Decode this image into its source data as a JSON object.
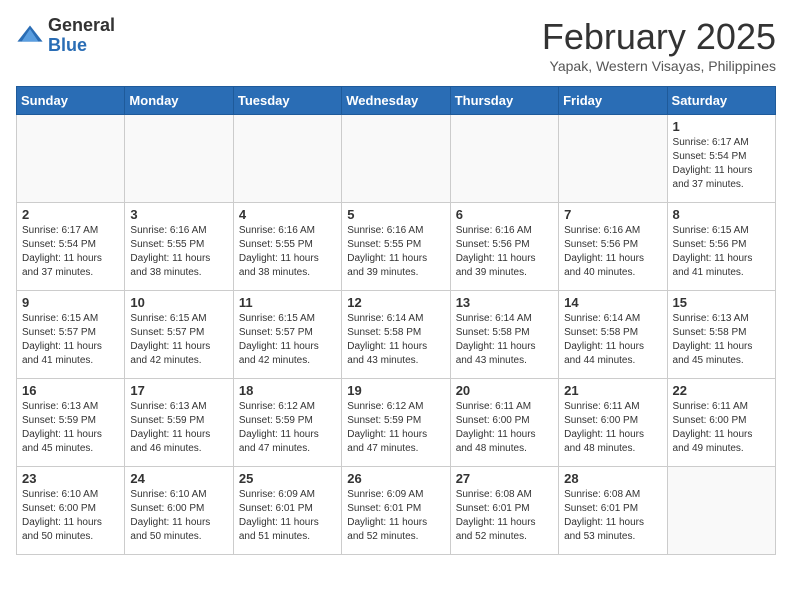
{
  "header": {
    "logo_general": "General",
    "logo_blue": "Blue",
    "month_title": "February 2025",
    "location": "Yapak, Western Visayas, Philippines"
  },
  "days_of_week": [
    "Sunday",
    "Monday",
    "Tuesday",
    "Wednesday",
    "Thursday",
    "Friday",
    "Saturday"
  ],
  "weeks": [
    [
      {
        "day": "",
        "info": ""
      },
      {
        "day": "",
        "info": ""
      },
      {
        "day": "",
        "info": ""
      },
      {
        "day": "",
        "info": ""
      },
      {
        "day": "",
        "info": ""
      },
      {
        "day": "",
        "info": ""
      },
      {
        "day": "1",
        "info": "Sunrise: 6:17 AM\nSunset: 5:54 PM\nDaylight: 11 hours\nand 37 minutes."
      }
    ],
    [
      {
        "day": "2",
        "info": "Sunrise: 6:17 AM\nSunset: 5:54 PM\nDaylight: 11 hours\nand 37 minutes."
      },
      {
        "day": "3",
        "info": "Sunrise: 6:16 AM\nSunset: 5:55 PM\nDaylight: 11 hours\nand 38 minutes."
      },
      {
        "day": "4",
        "info": "Sunrise: 6:16 AM\nSunset: 5:55 PM\nDaylight: 11 hours\nand 38 minutes."
      },
      {
        "day": "5",
        "info": "Sunrise: 6:16 AM\nSunset: 5:55 PM\nDaylight: 11 hours\nand 39 minutes."
      },
      {
        "day": "6",
        "info": "Sunrise: 6:16 AM\nSunset: 5:56 PM\nDaylight: 11 hours\nand 39 minutes."
      },
      {
        "day": "7",
        "info": "Sunrise: 6:16 AM\nSunset: 5:56 PM\nDaylight: 11 hours\nand 40 minutes."
      },
      {
        "day": "8",
        "info": "Sunrise: 6:15 AM\nSunset: 5:56 PM\nDaylight: 11 hours\nand 41 minutes."
      }
    ],
    [
      {
        "day": "9",
        "info": "Sunrise: 6:15 AM\nSunset: 5:57 PM\nDaylight: 11 hours\nand 41 minutes."
      },
      {
        "day": "10",
        "info": "Sunrise: 6:15 AM\nSunset: 5:57 PM\nDaylight: 11 hours\nand 42 minutes."
      },
      {
        "day": "11",
        "info": "Sunrise: 6:15 AM\nSunset: 5:57 PM\nDaylight: 11 hours\nand 42 minutes."
      },
      {
        "day": "12",
        "info": "Sunrise: 6:14 AM\nSunset: 5:58 PM\nDaylight: 11 hours\nand 43 minutes."
      },
      {
        "day": "13",
        "info": "Sunrise: 6:14 AM\nSunset: 5:58 PM\nDaylight: 11 hours\nand 43 minutes."
      },
      {
        "day": "14",
        "info": "Sunrise: 6:14 AM\nSunset: 5:58 PM\nDaylight: 11 hours\nand 44 minutes."
      },
      {
        "day": "15",
        "info": "Sunrise: 6:13 AM\nSunset: 5:58 PM\nDaylight: 11 hours\nand 45 minutes."
      }
    ],
    [
      {
        "day": "16",
        "info": "Sunrise: 6:13 AM\nSunset: 5:59 PM\nDaylight: 11 hours\nand 45 minutes."
      },
      {
        "day": "17",
        "info": "Sunrise: 6:13 AM\nSunset: 5:59 PM\nDaylight: 11 hours\nand 46 minutes."
      },
      {
        "day": "18",
        "info": "Sunrise: 6:12 AM\nSunset: 5:59 PM\nDaylight: 11 hours\nand 47 minutes."
      },
      {
        "day": "19",
        "info": "Sunrise: 6:12 AM\nSunset: 5:59 PM\nDaylight: 11 hours\nand 47 minutes."
      },
      {
        "day": "20",
        "info": "Sunrise: 6:11 AM\nSunset: 6:00 PM\nDaylight: 11 hours\nand 48 minutes."
      },
      {
        "day": "21",
        "info": "Sunrise: 6:11 AM\nSunset: 6:00 PM\nDaylight: 11 hours\nand 48 minutes."
      },
      {
        "day": "22",
        "info": "Sunrise: 6:11 AM\nSunset: 6:00 PM\nDaylight: 11 hours\nand 49 minutes."
      }
    ],
    [
      {
        "day": "23",
        "info": "Sunrise: 6:10 AM\nSunset: 6:00 PM\nDaylight: 11 hours\nand 50 minutes."
      },
      {
        "day": "24",
        "info": "Sunrise: 6:10 AM\nSunset: 6:00 PM\nDaylight: 11 hours\nand 50 minutes."
      },
      {
        "day": "25",
        "info": "Sunrise: 6:09 AM\nSunset: 6:01 PM\nDaylight: 11 hours\nand 51 minutes."
      },
      {
        "day": "26",
        "info": "Sunrise: 6:09 AM\nSunset: 6:01 PM\nDaylight: 11 hours\nand 52 minutes."
      },
      {
        "day": "27",
        "info": "Sunrise: 6:08 AM\nSunset: 6:01 PM\nDaylight: 11 hours\nand 52 minutes."
      },
      {
        "day": "28",
        "info": "Sunrise: 6:08 AM\nSunset: 6:01 PM\nDaylight: 11 hours\nand 53 minutes."
      },
      {
        "day": "",
        "info": ""
      }
    ]
  ]
}
